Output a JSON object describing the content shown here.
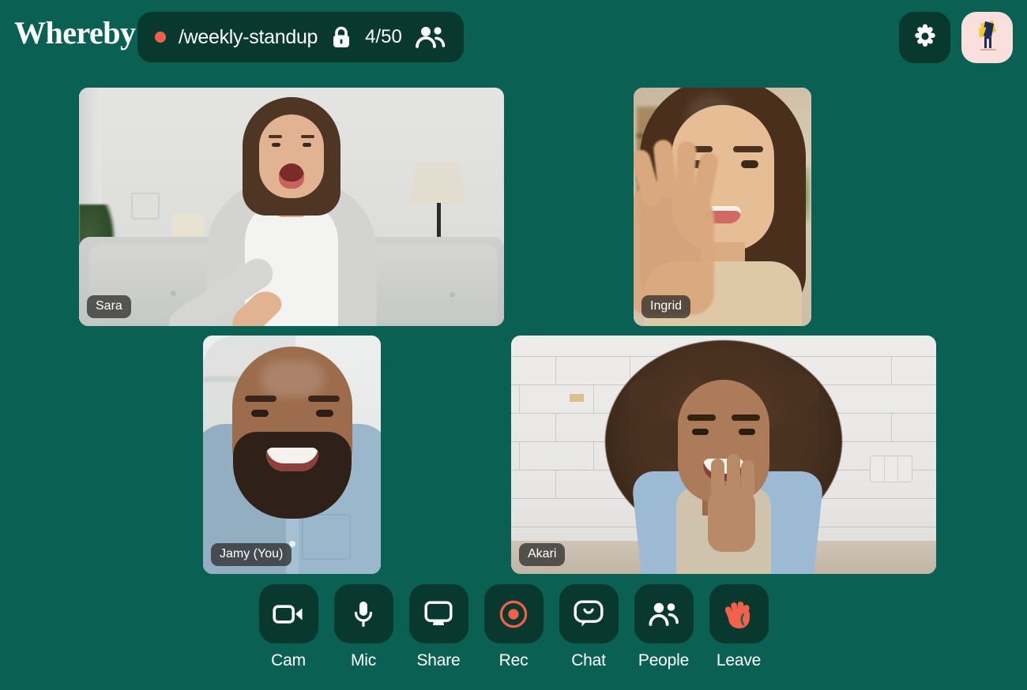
{
  "app": {
    "name": "Whereby",
    "background_color": "#0a6153",
    "panel_color": "#09382f",
    "accent_color": "#f4614a"
  },
  "header": {
    "logo_text": "Whereby",
    "room": {
      "live_indicator": "live-dot",
      "name": "/weekly-standup",
      "lock_icon": "lock-icon",
      "participant_count": "4/50",
      "people_icon": "people-icon"
    },
    "settings_button": {
      "icon": "gear-icon",
      "label": "Settings"
    },
    "avatar_button": {
      "icon": "avatar",
      "label": "Profile",
      "background_color": "#fae0dc"
    }
  },
  "grid": {
    "participants": [
      {
        "id": "sara",
        "name": "Sara",
        "layout": "wide-top-left"
      },
      {
        "id": "ingrid",
        "name": "Ingrid",
        "layout": "portrait-top-right"
      },
      {
        "id": "jamy",
        "name": "Jamy (You)",
        "layout": "portrait-bottom-left"
      },
      {
        "id": "akari",
        "name": "Akari",
        "layout": "wide-bottom-right"
      }
    ]
  },
  "toolbar": {
    "buttons": [
      {
        "id": "cam",
        "label": "Cam",
        "icon": "camera-icon"
      },
      {
        "id": "mic",
        "label": "Mic",
        "icon": "microphone-icon"
      },
      {
        "id": "share",
        "label": "Share",
        "icon": "monitor-icon"
      },
      {
        "id": "rec",
        "label": "Rec",
        "icon": "record-icon"
      },
      {
        "id": "chat",
        "label": "Chat",
        "icon": "chat-bubble-icon"
      },
      {
        "id": "people",
        "label": "People",
        "icon": "people-icon"
      },
      {
        "id": "leave",
        "label": "Leave",
        "icon": "waving-hand-icon"
      }
    ]
  }
}
